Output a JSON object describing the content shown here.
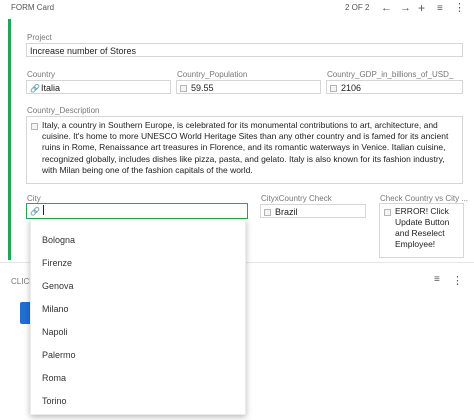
{
  "header": {
    "title": "FORM Card",
    "pager": "2 OF 2",
    "icons": [
      "arrow-left-icon",
      "arrow-right-icon",
      "plus-icon",
      "filter-icon",
      "more-icon"
    ]
  },
  "fields": {
    "project": {
      "label": "Project",
      "value": "Increase number of Stores"
    },
    "country": {
      "label": "Country",
      "value": "Italia"
    },
    "population": {
      "label": "Country_Population",
      "value": "59.55"
    },
    "gdp": {
      "label": "Country_GDP_in_billions_of_USD_",
      "value": "2106"
    },
    "description": {
      "label": "Country_Description",
      "value": "Italy, a country in Southern Europe, is celebrated for its monumental contributions to art, architecture, and cuisine. It's home to more UNESCO World Heritage Sites than any other country and is famed for its ancient ruins in Rome, Renaissance art treasures in Florence, and its romantic waterways in Venice. Italian cuisine, recognized globally, includes dishes like pizza, pasta, and gelato. Italy is also known for its fashion industry, with Milan being one of the fashion capitals of the world."
    },
    "city": {
      "label": "City",
      "value": ""
    },
    "city_country_check": {
      "label": "CityxCountry Check",
      "value": "Brazil"
    },
    "check_country_vs_city": {
      "label": "Check Country vs City ...",
      "value": "ERROR! Click Update Button and Reselect Employee!"
    }
  },
  "dropdown": {
    "options": [
      "Bologna",
      "Firenze",
      "Genova",
      "Milano",
      "Napoli",
      "Palermo",
      "Roma",
      "Torino"
    ]
  },
  "lower_card": {
    "title": "CLICK"
  },
  "colors": {
    "accent": "#22a555",
    "button": "#1f6fd6"
  }
}
